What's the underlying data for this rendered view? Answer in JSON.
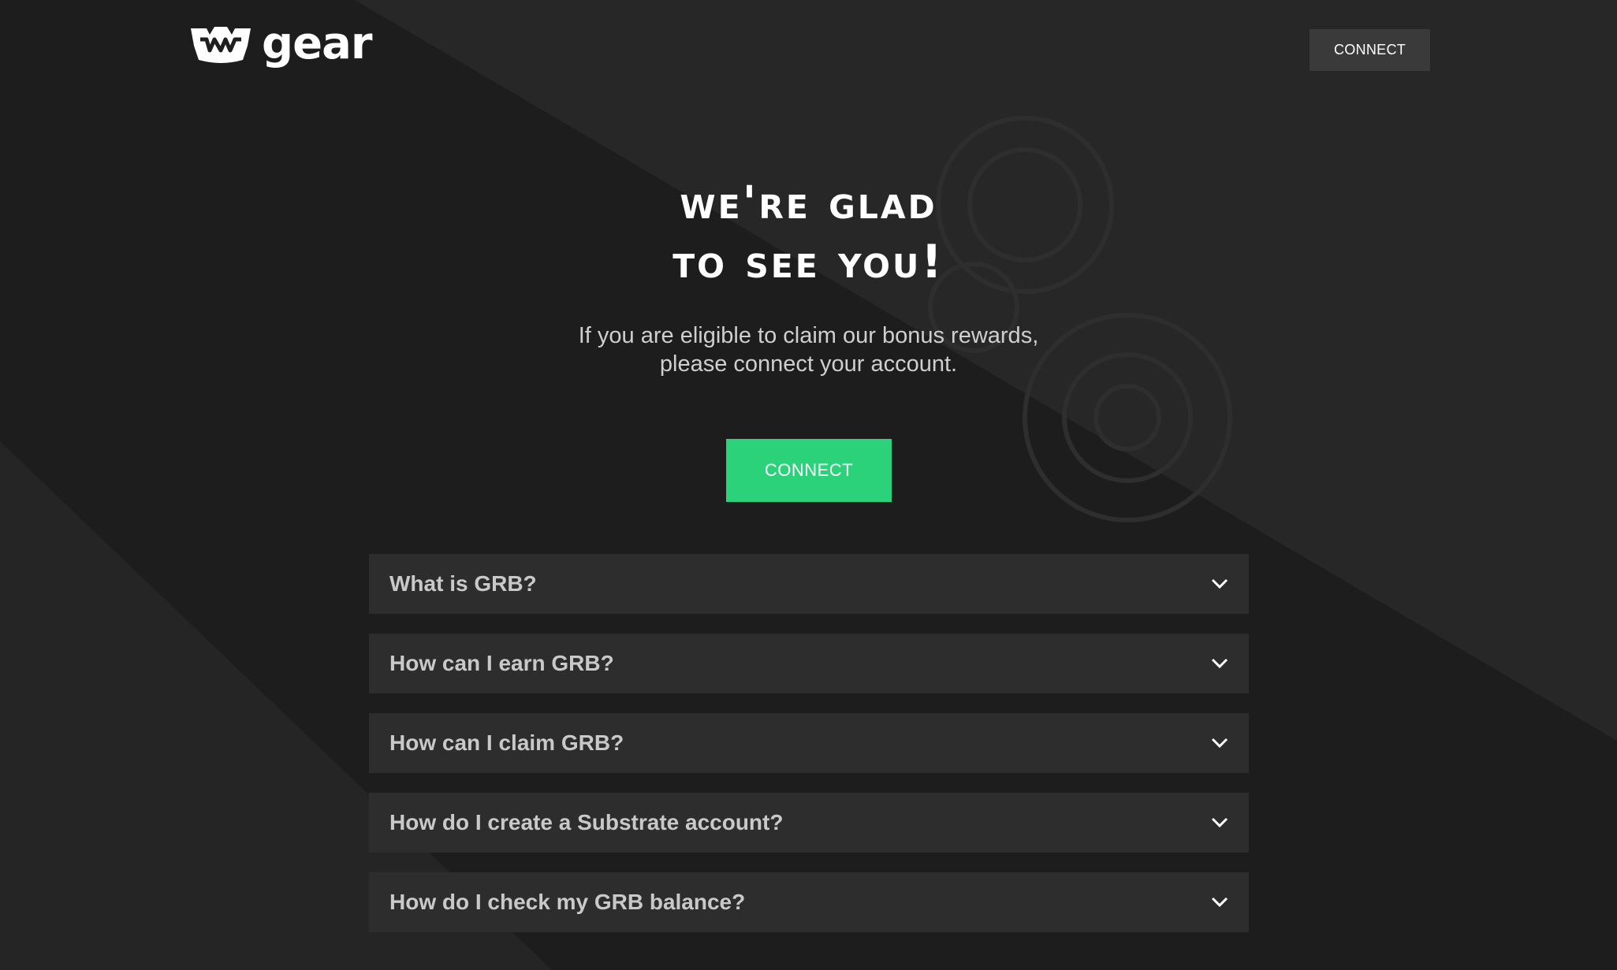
{
  "header": {
    "logo_text": "gear",
    "connect_label": "CONNECT"
  },
  "hero": {
    "title_line1": "We're glad",
    "title_line2": "to see you!",
    "subtitle_line1": "If you are eligible to claim our bonus rewards,",
    "subtitle_line2": "please connect your account.",
    "connect_label": "CONNECT"
  },
  "faq": {
    "items": [
      {
        "question": "What is GRB?",
        "icon": "chevron-down-icon"
      },
      {
        "question": "How can I earn GRB?",
        "icon": "chevron-down-icon"
      },
      {
        "question": "How can I claim GRB?",
        "icon": "chevron-down-icon"
      },
      {
        "question": "How do I create a Substrate account?",
        "icon": "chevron-down-icon"
      },
      {
        "question": "How do I check my GRB balance?",
        "icon": "chevron-down-icon"
      }
    ]
  },
  "colors": {
    "background": "#1f1f1f",
    "accent": "#2bd27a",
    "faq_background": "#2d2d2d",
    "secondary_button": "#3a3a3a"
  }
}
